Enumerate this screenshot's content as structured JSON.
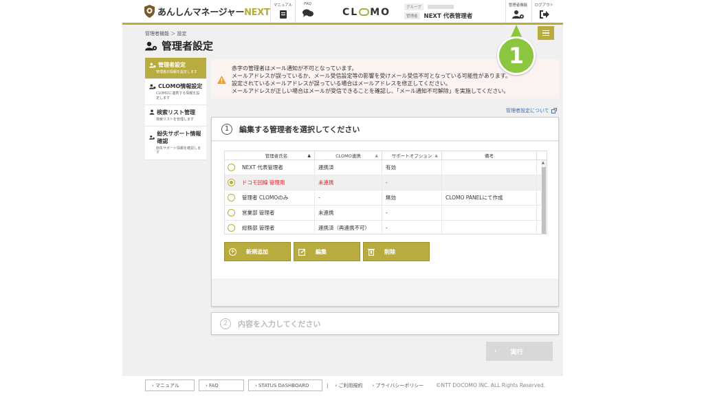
{
  "header": {
    "app_name": "あんしんマネージャー",
    "app_name_suffix": "NEXT",
    "manual_label": "マニュアル",
    "faq_label": "FAQ",
    "brand": "CLOMO",
    "group_tag": "グループ",
    "admin_tag": "管理者",
    "admin_name": "NEXT 代表管理者",
    "admin_func_label": "管理者機能",
    "logout_label": "ログアウト"
  },
  "breadcrumb": "管理者機能 ＞ 設定",
  "page_title": "管理者設定",
  "sidebar": {
    "items": [
      {
        "label": "管理者設定",
        "desc": "管理者の情報を設定します",
        "icon": "admin-icon",
        "active": true
      },
      {
        "label": "CLOMO情報設定",
        "desc": "CLOMOに連携する情報を設定します",
        "icon": "admin-icon",
        "active": false
      },
      {
        "label": "検索リスト管理",
        "desc": "検索リストを管理します",
        "icon": "user-icon",
        "active": false
      },
      {
        "label": "紛失サポート情報確認",
        "desc": "紛失サポート情報を確認します",
        "icon": "admin-icon",
        "active": false
      }
    ]
  },
  "alert": {
    "lines": [
      "赤字の管理者はメール通知が不可となっています。",
      "メールアドレスが誤っているか、メール受信設定等の影響を受けメール受信不可となっている可能性があります。",
      "設定されているメールアドレスが誤っている場合はメールアドレスを修正してください。",
      "メールアドレスが正しい場合はメールが受信できることを確認し、「メール通知不可解除」を実施してください。"
    ]
  },
  "about_link": "管理者設定について",
  "step1": {
    "num": "1",
    "title": "編集する管理者を選択してください",
    "columns": [
      "管理者氏名",
      "CLOMO連携",
      "サポートオプション",
      "備考"
    ],
    "rows": [
      {
        "name": "NEXT 代表管理者",
        "clomo": "連携済",
        "support": "有効",
        "note": "",
        "selected": false,
        "error": false
      },
      {
        "name": "ドコモ回線 管理用",
        "clomo": "未連携",
        "support": "-",
        "note": "",
        "selected": true,
        "error": true
      },
      {
        "name": "管理者 CLOMOのみ",
        "clomo": "-",
        "support": "無効",
        "note": "CLOMO PANELにて作成",
        "selected": false,
        "error": false
      },
      {
        "name": "営業部 管理者",
        "clomo": "未連携",
        "support": "-",
        "note": "",
        "selected": false,
        "error": false
      },
      {
        "name": "総務部 管理者",
        "clomo": "連携済（再連携不可）",
        "support": "-",
        "note": "",
        "selected": false,
        "error": false
      }
    ],
    "buttons": {
      "add": "新規追加",
      "edit": "編集",
      "delete": "削除"
    }
  },
  "step2": {
    "num": "2",
    "title": "内容を入力してください"
  },
  "execute_label": "実行",
  "footer": {
    "manual": "マニュアル",
    "faq": "FAQ",
    "status": "STATUS DASHBOARD",
    "terms": "ご利用規約",
    "privacy": "プライバシーポリシー",
    "copyright": "©NTT DOCOMO INC. ALL Rights Reserved."
  },
  "callout_number": "1",
  "colors": {
    "accent": "#b9ac3f",
    "callout": "#8cc63f",
    "error": "#e02020",
    "link": "#3a6fb5"
  }
}
